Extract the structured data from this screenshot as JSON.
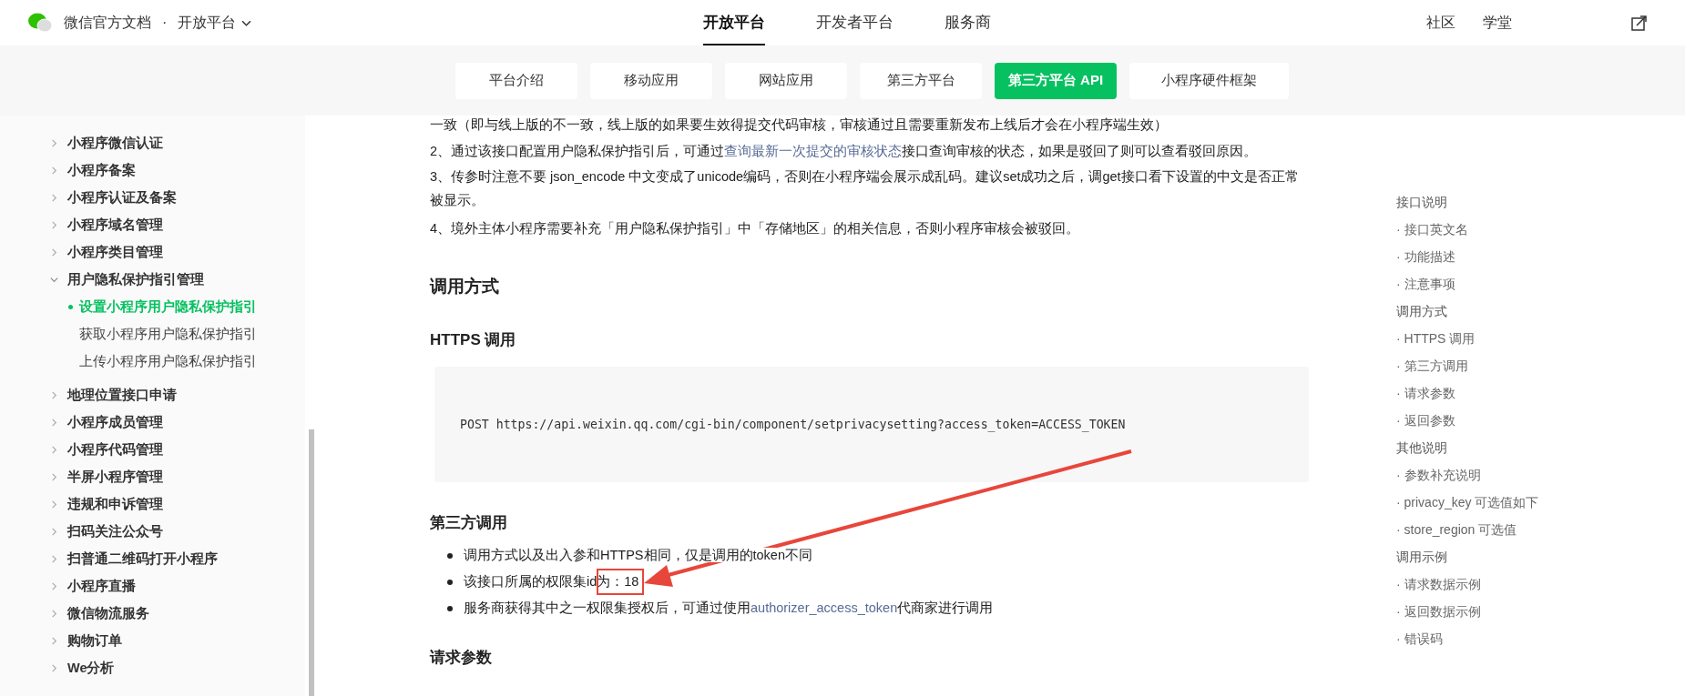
{
  "header": {
    "brand": "微信官方文档",
    "separator": "·",
    "platform": "开放平台",
    "nav": [
      {
        "label": "开放平台",
        "selected": true
      },
      {
        "label": "开发者平台",
        "selected": false
      },
      {
        "label": "服务商",
        "selected": false
      }
    ],
    "links": [
      "社区",
      "学堂"
    ]
  },
  "panel_tabs": [
    {
      "label": "平台介绍",
      "selected": false
    },
    {
      "label": "移动应用",
      "selected": false
    },
    {
      "label": "网站应用",
      "selected": false
    },
    {
      "label": "第三方平台",
      "selected": false
    },
    {
      "label": "第三方平台 API",
      "selected": true
    },
    {
      "label": "小程序硬件框架",
      "selected": false
    }
  ],
  "sidebar": {
    "items": [
      {
        "label": "小程序微信认证",
        "expanded": false
      },
      {
        "label": "小程序备案",
        "expanded": false
      },
      {
        "label": "小程序认证及备案",
        "expanded": false
      },
      {
        "label": "小程序域名管理",
        "expanded": false
      },
      {
        "label": "小程序类目管理",
        "expanded": false
      },
      {
        "label": "用户隐私保护指引管理",
        "expanded": true,
        "children": [
          {
            "label": "设置小程序用户隐私保护指引",
            "selected": true
          },
          {
            "label": "获取小程序用户隐私保护指引",
            "selected": false
          },
          {
            "label": "上传小程序用户隐私保护指引",
            "selected": false
          }
        ]
      },
      {
        "label": "地理位置接口申请",
        "expanded": false
      },
      {
        "label": "小程序成员管理",
        "expanded": false
      },
      {
        "label": "小程序代码管理",
        "expanded": false
      },
      {
        "label": "半屏小程序管理",
        "expanded": false
      },
      {
        "label": "违规和申诉管理",
        "expanded": false
      },
      {
        "label": "扫码关注公众号",
        "expanded": false
      },
      {
        "label": "扫普通二维码打开小程序",
        "expanded": false
      },
      {
        "label": "小程序直播",
        "expanded": false
      },
      {
        "label": "微信物流服务",
        "expanded": false
      },
      {
        "label": "购物订单",
        "expanded": false
      },
      {
        "label": "We分析",
        "expanded": false
      }
    ]
  },
  "notes": [
    {
      "text": "一致（即与线上版的不一致，线上版的如果要生效得提交代码审核，审核通过且需要重新发布上线后才会在小程序端生效）"
    },
    {
      "text": "2、通过该接口配置用户隐私保护指引后，可通过",
      "link": "查询最新一次提交的审核状态",
      "after": "接口查询审核的状态，如果是驳回了则可以查看驳回原因。"
    },
    {
      "text": "3、传参时注意不要 json_encode 中文变成了unicode编码，否则在小程序端会展示成乱码。建议set成功之后，调get接口看下设置的中文是否正常被显示。"
    },
    {
      "text": "4、境外主体小程序需要补充「用户隐私保护指引」中「存储地区」的相关信息，否则小程序审核会被驳回。"
    }
  ],
  "call_method": {
    "heading": "调用方式",
    "https_heading": "HTTPS 调用",
    "code": "POST https://api.weixin.qq.com/cgi-bin/component/setprivacysetting?access_token=ACCESS_TOKEN"
  },
  "third_party": {
    "heading": "第三方调用",
    "bullets": [
      {
        "text": "调用方式以及出入参和HTTPS相同，仅是调用的token不同",
        "highlighted": false
      },
      {
        "text": "该接口所属的权限集id为：18",
        "highlighted": true
      },
      {
        "text": "服务商获得其中之一权限集授权后，可通过使用",
        "link": "authorizer_access_token",
        "after": "代商家进行调用",
        "highlighted": false
      }
    ]
  },
  "request_heading": "请求参数",
  "toc": [
    {
      "label": "接口说明",
      "kind": "section"
    },
    {
      "label": "· 接口英文名",
      "kind": "sub"
    },
    {
      "label": "· 功能描述",
      "kind": "sub"
    },
    {
      "label": "· 注意事项",
      "kind": "sub"
    },
    {
      "label": "调用方式",
      "kind": "section"
    },
    {
      "label": "· HTTPS 调用",
      "kind": "sub"
    },
    {
      "label": "· 第三方调用",
      "kind": "sub"
    },
    {
      "label": "· 请求参数",
      "kind": "sub"
    },
    {
      "label": "· 返回参数",
      "kind": "sub"
    },
    {
      "label": "其他说明",
      "kind": "section"
    },
    {
      "label": "· 参数补充说明",
      "kind": "sub"
    },
    {
      "label": "· privacy_key 可选值如下",
      "kind": "sub"
    },
    {
      "label": "· store_region 可选值",
      "kind": "sub"
    },
    {
      "label": "调用示例",
      "kind": "section"
    },
    {
      "label": "· 请求数据示例",
      "kind": "sub"
    },
    {
      "label": "· 返回数据示例",
      "kind": "sub"
    },
    {
      "label": "· 错误码",
      "kind": "sub"
    }
  ]
}
